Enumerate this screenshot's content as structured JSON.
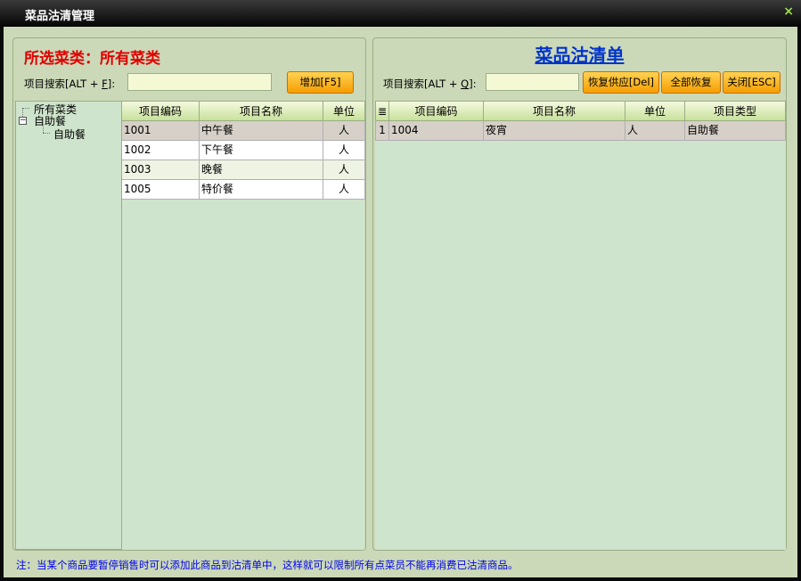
{
  "window": {
    "title": "菜品沽清管理",
    "close_symbol": "×"
  },
  "left": {
    "selected_title": "所选菜类：所有菜类",
    "search": {
      "label_prefix": "项目搜索[ALT + ",
      "label_key": "F",
      "label_suffix": "]:",
      "value": ""
    },
    "add_button": "增加[F5]",
    "tree": {
      "root": "所有菜类",
      "group": "自助餐",
      "child": "自助餐",
      "expander": "−"
    },
    "grid": {
      "columns": [
        "项目编码",
        "项目名称",
        "单位"
      ],
      "rows": [
        [
          "1001",
          "中午餐",
          "人"
        ],
        [
          "1002",
          "下午餐",
          "人"
        ],
        [
          "1003",
          "晚餐",
          "人"
        ],
        [
          "1005",
          "特价餐",
          "人"
        ]
      ]
    }
  },
  "right": {
    "title": "菜品沽清单",
    "search": {
      "label_prefix": "项目搜索[ALT + ",
      "label_key": "Q",
      "label_suffix": "]:",
      "value": ""
    },
    "buttons": {
      "restore": "恢复供应[Del]",
      "restore_all": "全部恢复",
      "close": "关闭[ESC]"
    },
    "grid": {
      "corner_icon": "≣",
      "columns": [
        "项目编码",
        "项目名称",
        "单位",
        "项目类型"
      ],
      "rows": [
        [
          "1",
          "1004",
          "夜宵",
          "人",
          "自助餐"
        ]
      ]
    }
  },
  "footnote": "注：当某个商品要暂停销售时可以添加此商品到沽清单中，这样就可以限制所有点菜员不能再消费已沽清商品。",
  "colors": {
    "accent_red": "#e00000",
    "title_blue": "#0033cc",
    "button_orange": "#f5a800",
    "bg_green": "#cbd9b8",
    "selected_row": "#d6d0c8"
  }
}
